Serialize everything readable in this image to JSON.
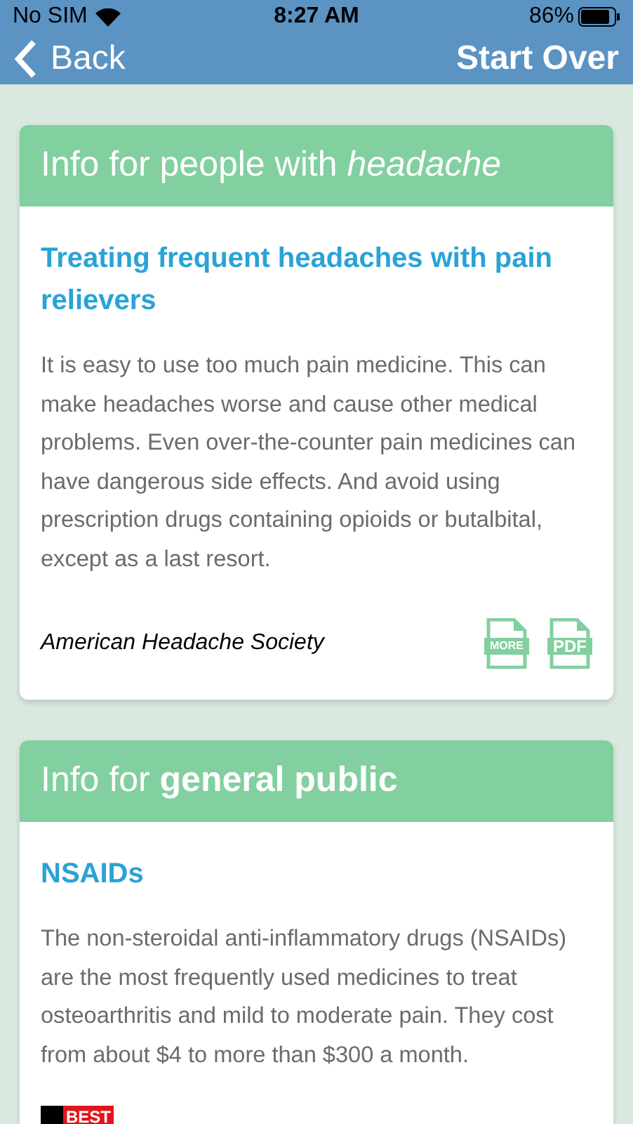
{
  "status_bar": {
    "carrier": "No SIM",
    "time": "8:27 AM",
    "battery": "86%"
  },
  "nav": {
    "back": "Back",
    "action": "Start Over"
  },
  "cards": [
    {
      "header_prefix": "Info for people with",
      "header_topic": "headache",
      "kind": "italic",
      "title": "Treating frequent headaches with pain relievers",
      "body": "It is easy to use too much pain medicine. This can make headaches worse and cause other medical problems. Even over-the-counter pain medicines can have dangerous side effects. And avoid using prescription drugs containing opioids or butalbital, except as a last resort.",
      "source": "American Headache Society",
      "links": [
        {
          "kind": "more",
          "label": "MORE"
        },
        {
          "kind": "pdf",
          "label": "PDF"
        }
      ]
    },
    {
      "header_prefix": "Info for",
      "header_topic": "general public",
      "kind": "bold",
      "title": "NSAIDs",
      "body": "The non-steroidal anti-inflammatory drugs (NSAIDs) are the most frequently used medicines to treat osteoarthritis and mild to moderate pain. They cost from about $4 to more than $300 a month.",
      "badge": "BEST"
    }
  ]
}
